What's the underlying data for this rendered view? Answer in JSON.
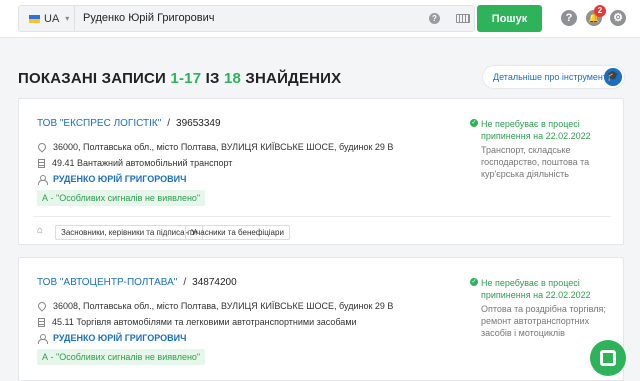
{
  "search": {
    "country_code": "UA",
    "query": "Руденко Юрій Григорович",
    "help_glyph": "?",
    "button_label": "Пошук"
  },
  "header_icons": {
    "help_glyph": "?",
    "notifications_count": "2",
    "settings_glyph": "⚙"
  },
  "title": {
    "prefix": "ПОКАЗАНІ ЗАПИСИ ",
    "range": "1-17",
    "middle": " ІЗ ",
    "total": "18",
    "suffix": " ЗНАЙДЕНИХ"
  },
  "detail_button": {
    "label": "Детальніше про інструмент",
    "icon": "graduation-cap-icon"
  },
  "records": [
    {
      "company": "ТОВ \"ЕКСПРЕС ЛОГІСТІК\"",
      "separator": "/",
      "code": "39653349",
      "address": "36000, Полтавська обл., місто Полтава, ВУЛИЦЯ КИЇВСЬКЕ ШОСЕ, будинок 29 В",
      "kved": "49.41 Вантажний автомобільний транспорт",
      "person": "РУДЕНКО ЮРІЙ ГРИГОРОВИЧ",
      "signal": "А - \"Особливих сигналів не виявлено\"",
      "status": "Не перебуває в процесі припинення на 22.02.2022",
      "activity": "Транспорт, складське господарство, поштова та кур'єрська діяльність",
      "tags": [
        "Засновники, керівники та підписанти",
        "Учасники та бенефіціари"
      ]
    },
    {
      "company": "ТОВ \"АВТОЦЕНТР-ПОЛТАВА\"",
      "separator": "/",
      "code": "34874200",
      "address": "36008, Полтавська обл., місто Полтава, ВУЛИЦЯ КИЇВСЬКЕ ШОСЕ, будинок 29 В",
      "kved": "45.11 Торгівля автомобілями та легковими автотранспортними засобами",
      "person": "РУДЕНКО ЮРІЙ ГРИГОРОВИЧ",
      "signal": "А - \"Особливих сигналів не виявлено\"",
      "status": "Не перебуває в процесі припинення на 22.02.2022",
      "activity": "Оптова та роздрібна торгівля; ремонт автотранспортних засобів і мотоциклів"
    }
  ],
  "colors": {
    "accent_green": "#2eb35a",
    "link_blue": "#1a6fc4",
    "badge_red": "#e53935"
  }
}
